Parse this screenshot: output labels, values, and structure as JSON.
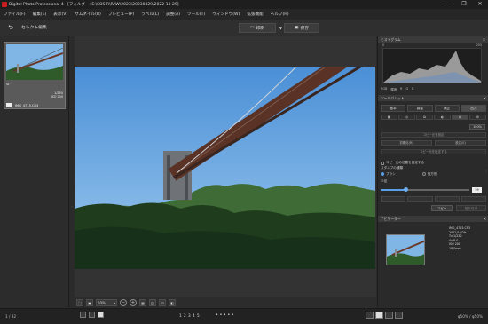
{
  "window": {
    "title": "Digital Photo Professional 4 - [フォルダー: E:\\EOS R\\RAW\\2023\\20230329\\2022-10-29]",
    "controls": [
      "—",
      "❐",
      "✕"
    ]
  },
  "menu": [
    "ファイル(F)",
    "編集(E)",
    "表示(V)",
    "サムネイル(B)",
    "プレビュー(P)",
    "ラベル(L)",
    "調整(A)",
    "ツール(T)",
    "ウィンドウ(W)",
    "拡張機能",
    "ヘルプ(H)"
  ],
  "toolbar": {
    "back_icon": "back-arrow-icon",
    "select_edit_label": "セレクト編集",
    "print_label": "印刷",
    "save_label": "保存"
  },
  "thumbnail": {
    "filename": "IMG_4715.CR3",
    "meta_lines": [
      "1/250",
      "ISO 200"
    ]
  },
  "viewer_toolbar": {
    "zoom": "50%"
  },
  "histogram": {
    "header": "ヒストグラム",
    "min_label": "0",
    "max_label": "255",
    "controls": [
      "RGB",
      "輝度",
      "R",
      "G",
      "B"
    ]
  },
  "toolpalette": {
    "header": "ツールパレット",
    "tabs": [
      "基本",
      "調整",
      "補正",
      "出力"
    ],
    "percent_btn": "100%",
    "btn_wide_1": "コピー元を設定",
    "btn_left": "初期化(R)",
    "btn_right": "設定(S)",
    "btn_wide_2": "コピー元を設定する",
    "checkbox_label": "コピー元の位置を固定する",
    "stamp_label": "スタンプの種類",
    "radio_brush": "ブラシ",
    "radio_spot": "長方形",
    "size_label": "半径",
    "size_value": "59",
    "size_fraction": 0.28,
    "copy_label": "コピー",
    "paste_label": "貼り付け"
  },
  "navigator": {
    "header": "ナビゲーター",
    "info_lines": [
      "IMG_4715.CR3",
      "2022/10/29",
      "Tv 1/250",
      "Av 8.0",
      "ISO 200",
      "18.0mm"
    ]
  },
  "status": {
    "count": "1 / 32",
    "ratings": "1 2 3 4 5",
    "zoom_readout": "φ50% / φ50%"
  }
}
